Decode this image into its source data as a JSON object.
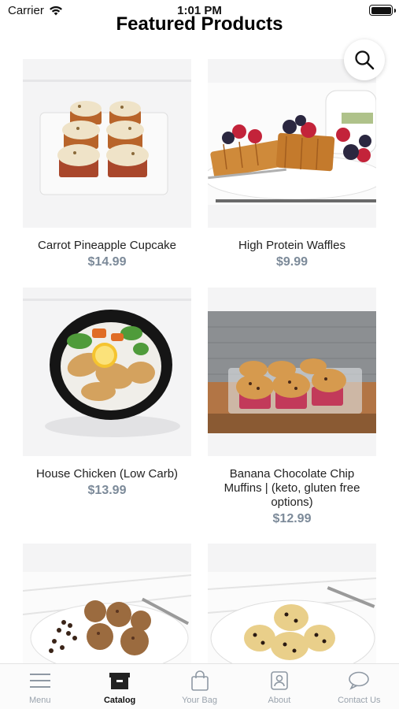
{
  "status_bar": {
    "carrier": "Carrier",
    "time": "1:01 PM",
    "battery_level": 1.0
  },
  "header": {
    "title": "Featured Products"
  },
  "products": [
    {
      "name": "Carrot Pineapple Cupcake",
      "price": "$14.99",
      "image": "cupcakes-photo"
    },
    {
      "name": "High Protein Waffles",
      "price": "$9.99",
      "image": "waffles-photo"
    },
    {
      "name": "House Chicken (Low Carb)",
      "price": "$13.99",
      "image": "chicken-bowl-photo"
    },
    {
      "name": "Banana Chocolate Chip Muffins | (keto, gluten free options)",
      "price": "$12.99",
      "image": "muffins-photo"
    },
    {
      "name": "",
      "price": "",
      "image": "protein-balls-photo"
    },
    {
      "name": "",
      "price": "",
      "image": "cookie-dough-photo"
    }
  ],
  "tabbar": {
    "tabs": [
      {
        "label": "Menu",
        "icon": "hamburger-menu-icon",
        "active": false
      },
      {
        "label": "Catalog",
        "icon": "box-icon",
        "active": true
      },
      {
        "label": "Your Bag",
        "icon": "shopping-bag-icon",
        "active": false
      },
      {
        "label": "About",
        "icon": "person-badge-icon",
        "active": false
      },
      {
        "label": "Contact Us",
        "icon": "chat-bubble-icon",
        "active": false
      }
    ]
  },
  "colors": {
    "price": "#7c8a99",
    "tab_inactive": "#9aa3ad",
    "tab_active": "#111111",
    "card_bg": "#f3f4f6"
  }
}
